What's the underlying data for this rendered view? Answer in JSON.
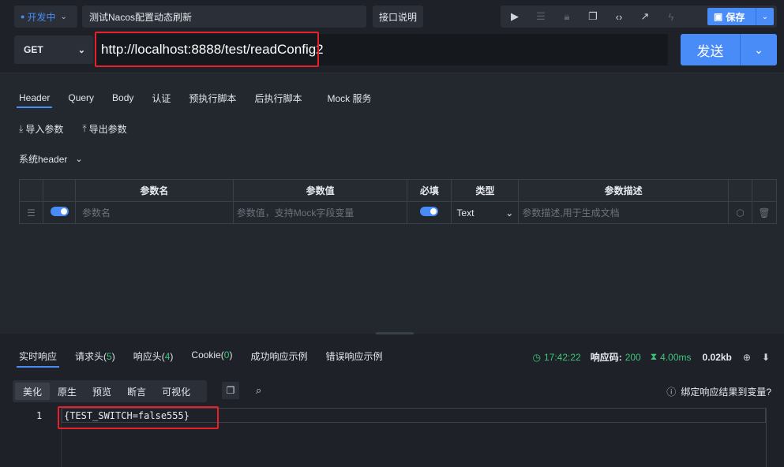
{
  "topbar": {
    "env_label": "开发中",
    "api_title": "测试Nacos配置动态刷新",
    "doc_label": "接口说明",
    "save_label": "保存"
  },
  "request": {
    "method": "GET",
    "url": "http://localhost:8888/test/readConfig2",
    "send_label": "发送"
  },
  "req_tabs": [
    "Header",
    "Query",
    "Body",
    "认证",
    "预执行脚本",
    "后执行脚本",
    "Mock 服务"
  ],
  "params": {
    "import_label": "导入参数",
    "export_label": "导出参数",
    "system_header_label": "系统header",
    "columns": [
      "参数名",
      "参数值",
      "必填",
      "类型",
      "参数描述"
    ],
    "row": {
      "name_placeholder": "参数名",
      "value_placeholder": "参数值，支持Mock字段变量",
      "type": "Text",
      "desc_placeholder": "参数描述,用于生成文档"
    }
  },
  "response": {
    "tabs": {
      "realtime": "实时响应",
      "req_headers": "请求头",
      "req_headers_count": "5",
      "resp_headers": "响应头",
      "resp_headers_count": "4",
      "cookie": "Cookie",
      "cookie_count": "0",
      "success_example": "成功响应示例",
      "error_example": "错误响应示例"
    },
    "stats": {
      "time": "17:42:22",
      "code_label": "响应码:",
      "code": "200",
      "duration": "4.00ms",
      "size": "0.02kb"
    },
    "view_modes": [
      "美化",
      "原生",
      "预览",
      "断言",
      "可视化"
    ],
    "bind_label": "绑定响应结果到变量?",
    "line_number": "1",
    "body": "{TEST_SWITCH=false555}"
  },
  "colors": {
    "accent": "#4a8cf7",
    "success": "#3fc47a",
    "highlight_box": "#e8202a"
  }
}
